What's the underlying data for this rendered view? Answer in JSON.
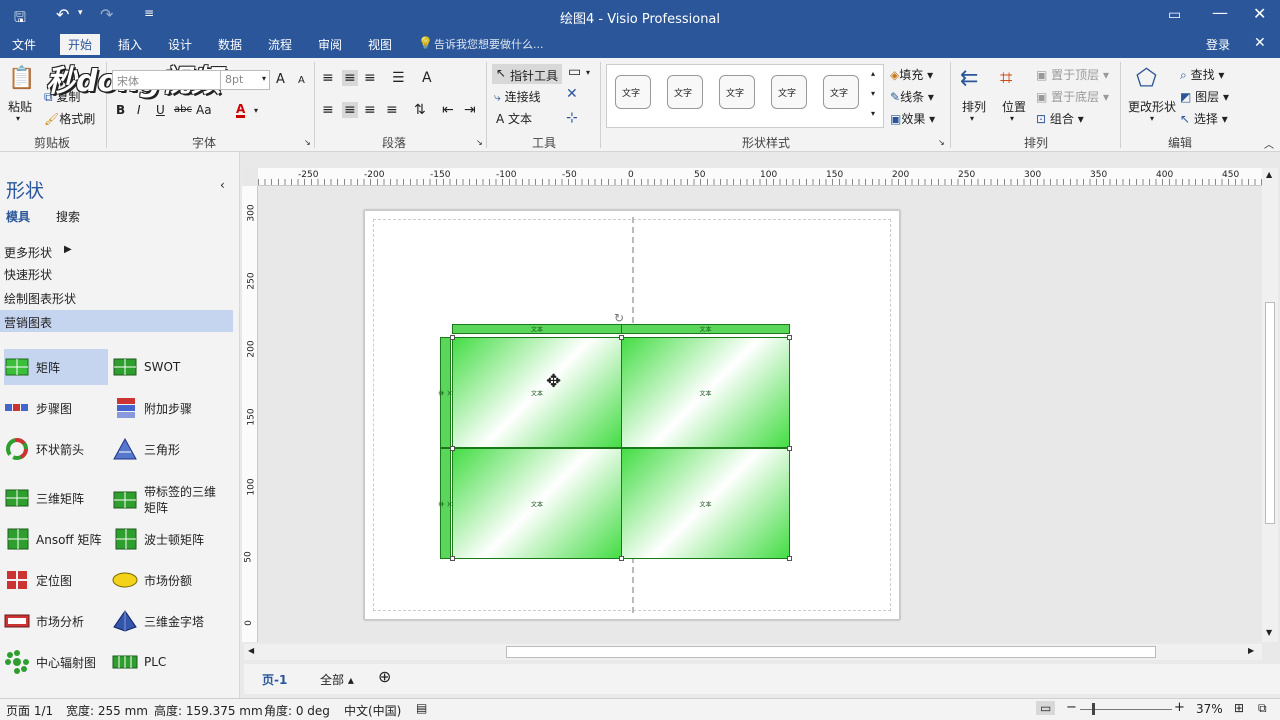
{
  "window": {
    "title": "绘图4 - Visio Professional"
  },
  "tabs": [
    "文件",
    "开始",
    "插入",
    "设计",
    "数据",
    "流程",
    "审阅",
    "视图"
  ],
  "tell_me": "告诉我您想要做什么...",
  "login": "登录",
  "watermark": "秒dong视频",
  "clipboard": {
    "paste": "粘贴",
    "copy": "复制",
    "format_painter": "格式刷",
    "label": "剪贴板"
  },
  "font": {
    "name": "宋体",
    "size": "8pt",
    "label": "字体",
    "bold": "B",
    "italic": "I",
    "underline": "U",
    "strike": "abc",
    "aa": "Aa",
    "grow": "A",
    "shrink": "A",
    "color": "A"
  },
  "paragraph": {
    "label": "段落"
  },
  "tools": {
    "pointer": "指针工具",
    "connector": "连接线",
    "text": "文本",
    "label": "工具"
  },
  "shape_styles": {
    "swatches": [
      "文字",
      "文字",
      "文字",
      "文字",
      "文字"
    ],
    "fill": "填充",
    "line": "线条",
    "effects": "效果",
    "label": "形状样式"
  },
  "arrange": {
    "arrange": "排列",
    "position": "位置",
    "bring_front": "置于顶层",
    "send_back": "置于底层",
    "group": "组合",
    "label": "排列"
  },
  "editing": {
    "change_shape": "更改形状",
    "find": "查找",
    "layers": "图层",
    "select": "选择",
    "label": "编辑"
  },
  "shapes_panel": {
    "title": "形状",
    "tab_stencils": "模具",
    "tab_search": "搜索",
    "more": "更多形状",
    "quick": "快速形状",
    "stencils": [
      "绘制图表形状",
      "营销图表"
    ],
    "items": [
      {
        "label": "矩阵",
        "icon": "matrix-icon"
      },
      {
        "label": "SWOT",
        "icon": "swot-icon"
      },
      {
        "label": "步骤图",
        "icon": "steps-icon"
      },
      {
        "label": "附加步骤",
        "icon": "additional-steps-icon"
      },
      {
        "label": "环状箭头",
        "icon": "circular-arrows-icon"
      },
      {
        "label": "三角形",
        "icon": "triangle-icon"
      },
      {
        "label": "三维矩阵",
        "icon": "3d-matrix-icon"
      },
      {
        "label": "带标签的三维矩阵",
        "icon": "labeled-3d-matrix-icon"
      },
      {
        "label": "Ansoff 矩阵",
        "icon": "ansoff-icon"
      },
      {
        "label": "波士顿矩阵",
        "icon": "boston-matrix-icon"
      },
      {
        "label": "定位图",
        "icon": "positioning-icon"
      },
      {
        "label": "市场份额",
        "icon": "market-share-icon"
      },
      {
        "label": "市场分析",
        "icon": "market-analysis-icon"
      },
      {
        "label": "三维金字塔",
        "icon": "pyramid-icon"
      },
      {
        "label": "中心辐射图",
        "icon": "hub-spoke-icon"
      },
      {
        "label": "PLC",
        "icon": "plc-icon"
      }
    ]
  },
  "ruler": {
    "top": [
      "-250",
      "-200",
      "-150",
      "-100",
      "-50",
      "0",
      "50",
      "100",
      "150",
      "200",
      "250",
      "300",
      "350",
      "400",
      "450"
    ],
    "left": [
      "300",
      "250",
      "200",
      "150",
      "100",
      "50",
      "0"
    ]
  },
  "diagram": {
    "cell_text": "文本"
  },
  "page_tabs": {
    "page": "页-1",
    "all": "全部"
  },
  "status": {
    "page": "页面 1/1",
    "width": "宽度: 255 mm",
    "height": "高度: 159.375 mm",
    "angle": "角度: 0 deg",
    "lang": "中文(中国)",
    "zoom": "37%"
  }
}
